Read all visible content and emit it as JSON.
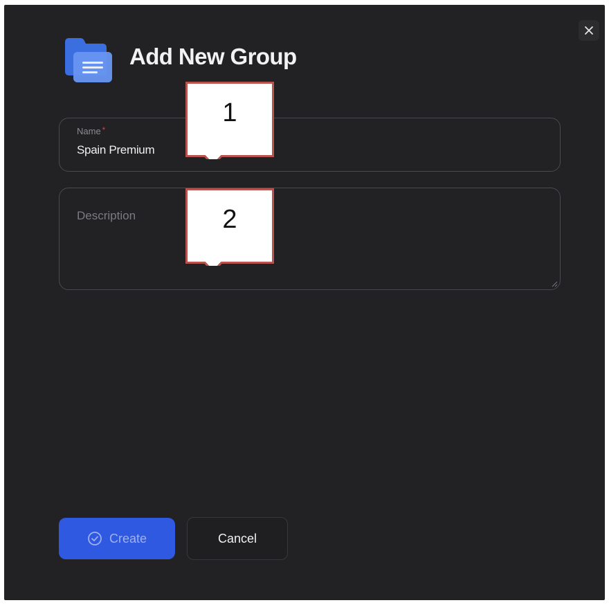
{
  "dialog": {
    "title": "Add New Group",
    "icon": "folder-document-icon",
    "close_icon": "close-icon"
  },
  "form": {
    "name": {
      "label": "Name",
      "required_marker": "*",
      "value": "Spain Premium"
    },
    "description": {
      "placeholder": "Description",
      "value": ""
    }
  },
  "annotations": [
    {
      "number": "1"
    },
    {
      "number": "2"
    }
  ],
  "actions": {
    "create_label": "Create",
    "create_icon": "check-circle-icon",
    "cancel_label": "Cancel"
  },
  "colors": {
    "background": "#222224",
    "accent": "#2f59e0",
    "required": "#e5484d",
    "callout_border": "#b85450"
  }
}
